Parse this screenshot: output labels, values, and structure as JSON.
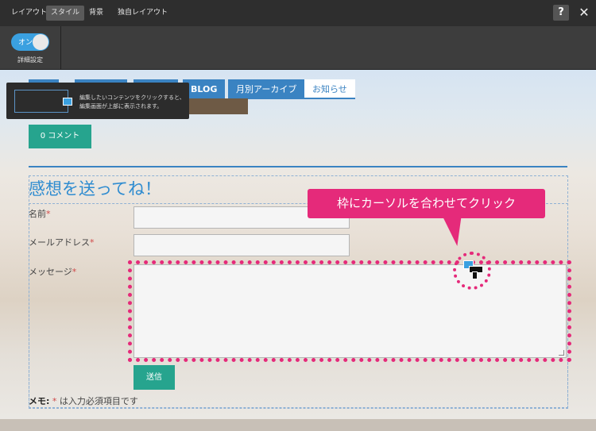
{
  "topbar": {
    "tabs": [
      {
        "label": "レイアウト",
        "active": false
      },
      {
        "label": "スタイル",
        "active": true
      },
      {
        "label": "背景",
        "active": false
      },
      {
        "label": "独自レイアウト",
        "active": false
      }
    ],
    "help_label": "?",
    "close_label": "✕"
  },
  "toolbar": {
    "toggle_text": "オン",
    "toggle_label": "詳細設定"
  },
  "nav": {
    "items": [
      "BLOG",
      "月別アーカイブ",
      "お知らせ"
    ]
  },
  "tooltip": {
    "line1": "編集したいコンテンツをクリックすると、",
    "line2": "編集画面が上部に表示されます。"
  },
  "comment_button": "0 コメント",
  "form": {
    "title": "感想を送ってね！",
    "name_label": "名前",
    "email_label": "メールアドレス",
    "message_label": "メッセージ",
    "required_mark": "*",
    "submit_label": "送信",
    "memo_prefix": "メモ:",
    "memo_mark": "*",
    "memo_text": " は入力必須項目です"
  },
  "callout": {
    "text": "枠にカーソルを合わせてクリック"
  },
  "colors": {
    "accent_blue": "#3a83c2",
    "teal": "#26a48e",
    "highlight_pink": "#e52a7a"
  }
}
